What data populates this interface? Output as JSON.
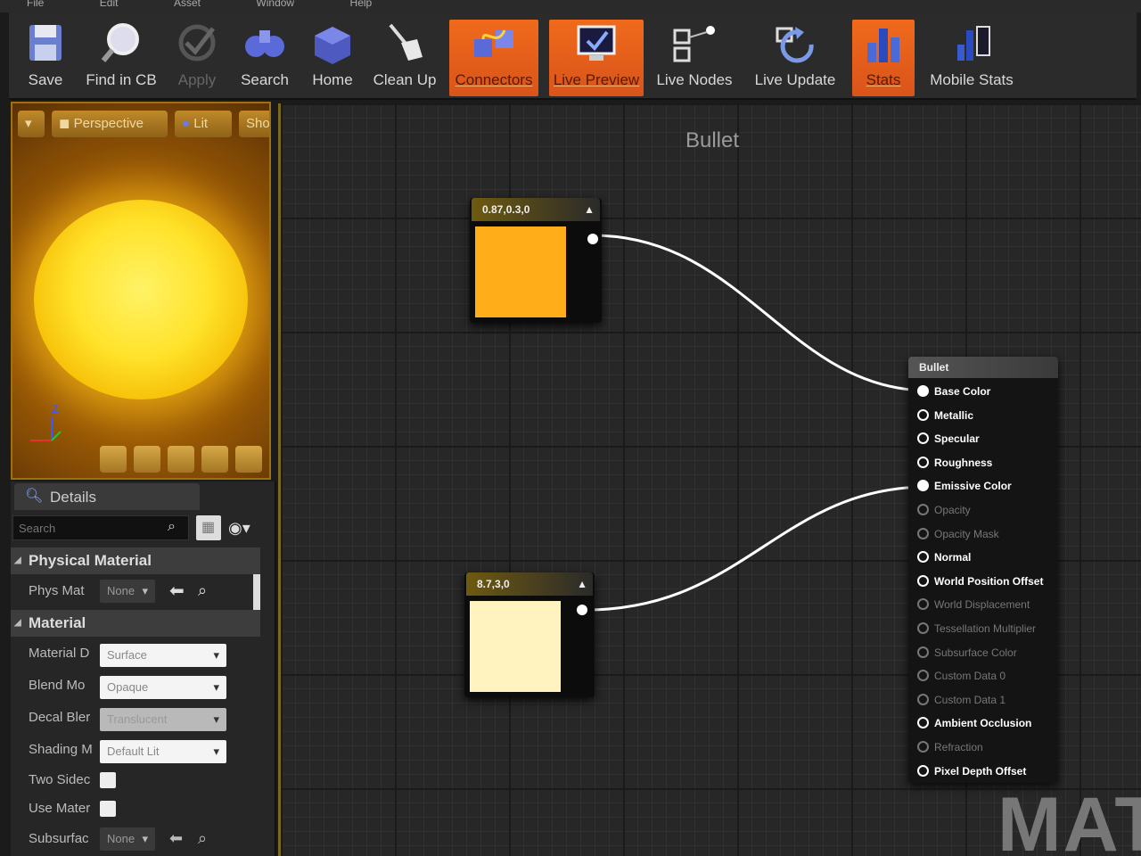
{
  "menu": [
    "File",
    "Edit",
    "Asset",
    "Window",
    "Help"
  ],
  "toolbar": {
    "save": "Save",
    "find_in_cb": "Find in CB",
    "apply": "Apply",
    "search": "Search",
    "home": "Home",
    "clean_up": "Clean Up",
    "connectors": "Connectors",
    "live_preview": "Live Preview",
    "live_nodes": "Live Nodes",
    "live_update": "Live Update",
    "stats": "Stats",
    "mobile_stats": "Mobile Stats"
  },
  "viewport": {
    "perspective": "Perspective",
    "lit": "Lit",
    "show": "Sho",
    "axis_z": "Z"
  },
  "details": {
    "tab": "Details",
    "search_placeholder": "Search",
    "physical_material": "Physical Material",
    "phys_mat_label": "Phys Mat",
    "phys_mat_value": "None",
    "material": "Material",
    "material_domain_label": "Material D",
    "material_domain_value": "Surface",
    "blend_mode_label": "Blend Mo",
    "blend_mode_value": "Opaque",
    "decal_blend_label": "Decal Bler",
    "decal_blend_value": "Translucent",
    "shading_model_label": "Shading M",
    "shading_model_value": "Default Lit",
    "two_sided_label": "Two Sidec",
    "use_material_label": "Use Mater",
    "subsurface_label": "Subsurfac",
    "subsurface_value": "None"
  },
  "graph": {
    "title": "Bullet",
    "watermark": "MATI",
    "const1": {
      "label": "0.87,0.3,0",
      "color": "#ffae1a"
    },
    "const2": {
      "label": "8.7,3,0",
      "color": "#fff3c0"
    },
    "material_node": {
      "title": "Bullet",
      "pins": [
        {
          "label": "Base Color",
          "state": "connected"
        },
        {
          "label": "Metallic",
          "state": "active"
        },
        {
          "label": "Specular",
          "state": "active"
        },
        {
          "label": "Roughness",
          "state": "active"
        },
        {
          "label": "Emissive Color",
          "state": "connected"
        },
        {
          "label": "Opacity",
          "state": "disabled"
        },
        {
          "label": "Opacity Mask",
          "state": "disabled"
        },
        {
          "label": "Normal",
          "state": "active"
        },
        {
          "label": "World Position Offset",
          "state": "active"
        },
        {
          "label": "World Displacement",
          "state": "disabled"
        },
        {
          "label": "Tessellation Multiplier",
          "state": "disabled"
        },
        {
          "label": "Subsurface Color",
          "state": "disabled"
        },
        {
          "label": "Custom Data 0",
          "state": "disabled"
        },
        {
          "label": "Custom Data 1",
          "state": "disabled"
        },
        {
          "label": "Ambient Occlusion",
          "state": "active"
        },
        {
          "label": "Refraction",
          "state": "disabled"
        },
        {
          "label": "Pixel Depth Offset",
          "state": "active"
        }
      ]
    }
  },
  "colors": {
    "accent": "#e8601c",
    "sphere": "#ffe22a"
  }
}
